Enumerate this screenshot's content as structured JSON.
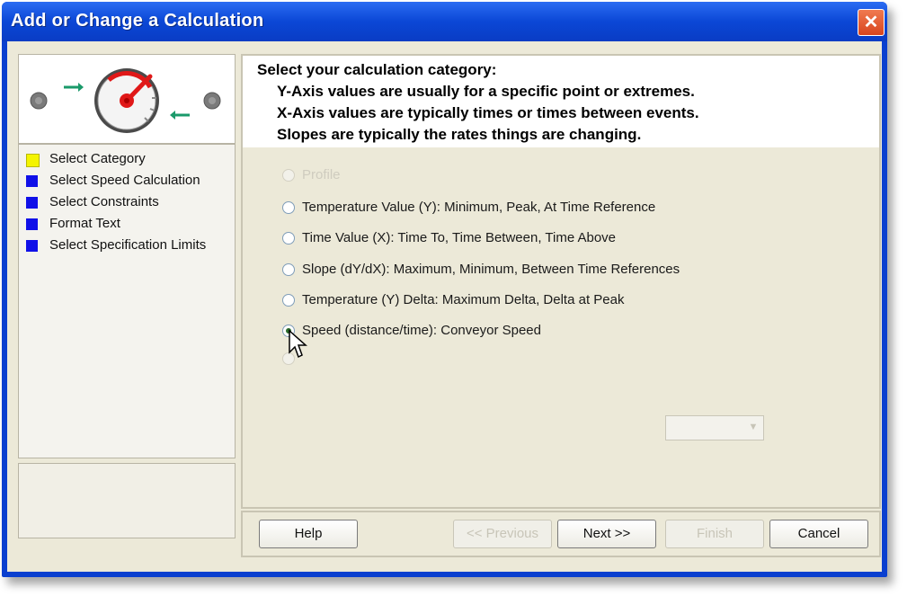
{
  "window": {
    "title": "Add or Change a Calculation",
    "close_glyph": "✕"
  },
  "steps": [
    {
      "label": "Select Category",
      "color": "#f4f400"
    },
    {
      "label": "Select Speed Calculation",
      "color": "#1010e8"
    },
    {
      "label": "Select Constraints",
      "color": "#1010e8"
    },
    {
      "label": "Format Text",
      "color": "#1010e8"
    },
    {
      "label": "Select Specification Limits",
      "color": "#1010e8"
    }
  ],
  "instructions": {
    "heading": "Select your calculation category:",
    "lines": [
      "Y-Axis values are usually for a specific point or extremes.",
      "X-Axis values are typically times or times between events.",
      "Slopes are typically the rates things are changing."
    ]
  },
  "options": [
    {
      "label": "Profile",
      "enabled": false,
      "selected": false
    },
    {
      "label": "Temperature Value (Y):  Minimum, Peak, At Time Reference",
      "enabled": true,
      "selected": false
    },
    {
      "label": "Time Value (X):  Time To, Time Between, Time Above",
      "enabled": true,
      "selected": false
    },
    {
      "label": "Slope (dY/dX):  Maximum, Minimum, Between Time References",
      "enabled": true,
      "selected": false
    },
    {
      "label": "Temperature (Y) Delta:  Maximum Delta, Delta at Peak",
      "enabled": true,
      "selected": false
    },
    {
      "label": "Speed (distance/time):  Conveyor Speed",
      "enabled": true,
      "selected": true
    },
    {
      "label": "",
      "enabled": false,
      "selected": false
    }
  ],
  "dropdown": {
    "label": "",
    "value": ""
  },
  "buttons": {
    "help": "Help",
    "back": "<< Previous",
    "next": "Next >>",
    "finish": "Finish",
    "cancel": "Cancel"
  },
  "colors": {
    "title_bar": "#0b47d6",
    "accent_needle": "#e01818",
    "arrow_green": "#1a9a6a"
  },
  "icons": [
    "close-icon",
    "gauge-icon",
    "arrow-right-icon",
    "arrow-left-icon",
    "mouse-cursor-icon"
  ]
}
